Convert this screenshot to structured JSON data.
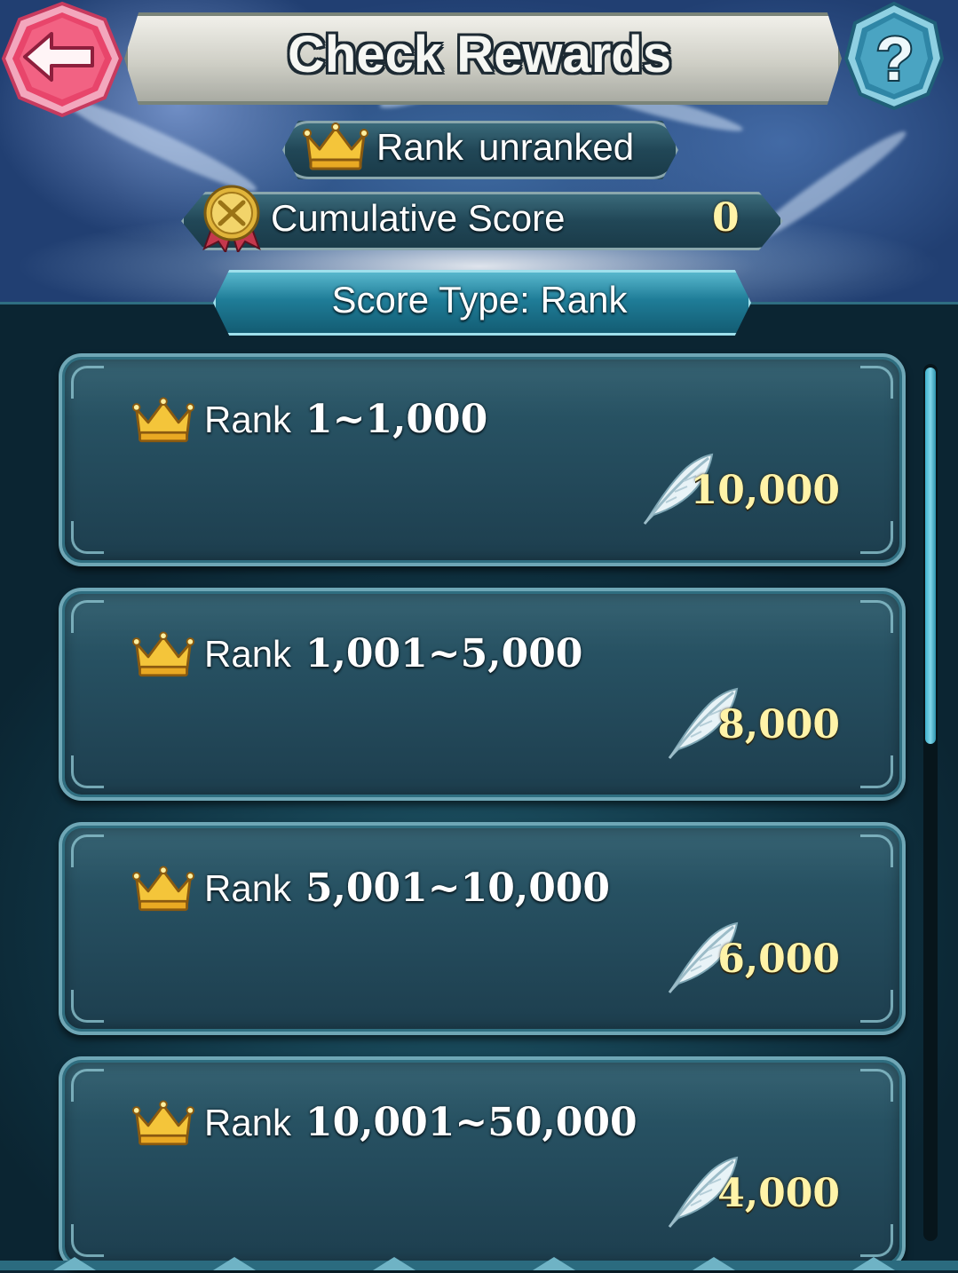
{
  "header": {
    "title": "Check Rewards",
    "back_icon": "back-arrow-icon",
    "help_icon": "question-mark-icon",
    "back_color": "#e8456b",
    "help_color": "#3a8fb0"
  },
  "summary": {
    "rank_label": "Rank",
    "rank_value": "unranked",
    "rank_icon": "crown-icon",
    "score_label": "Cumulative Score",
    "score_value": "0",
    "score_icon": "gold-medal-icon"
  },
  "score_type": {
    "label": "Score Type: Rank"
  },
  "rewards": [
    {
      "rank_label": "Rank",
      "range": "1~1,000",
      "amount": "10,000",
      "icon": "feather-icon"
    },
    {
      "rank_label": "Rank",
      "range": "1,001~5,000",
      "amount": "8,000",
      "icon": "feather-icon"
    },
    {
      "rank_label": "Rank",
      "range": "5,001~10,000",
      "amount": "6,000",
      "icon": "feather-icon"
    },
    {
      "rank_label": "Rank",
      "range": "10,001~50,000",
      "amount": "4,000",
      "icon": "feather-icon"
    }
  ],
  "colors": {
    "accent_gold": "#fff3a8",
    "panel_teal": "#23495a",
    "button_teal": "#1f7d98"
  },
  "scroll": {
    "position_fraction": 0.0,
    "visible_fraction": 0.43
  }
}
